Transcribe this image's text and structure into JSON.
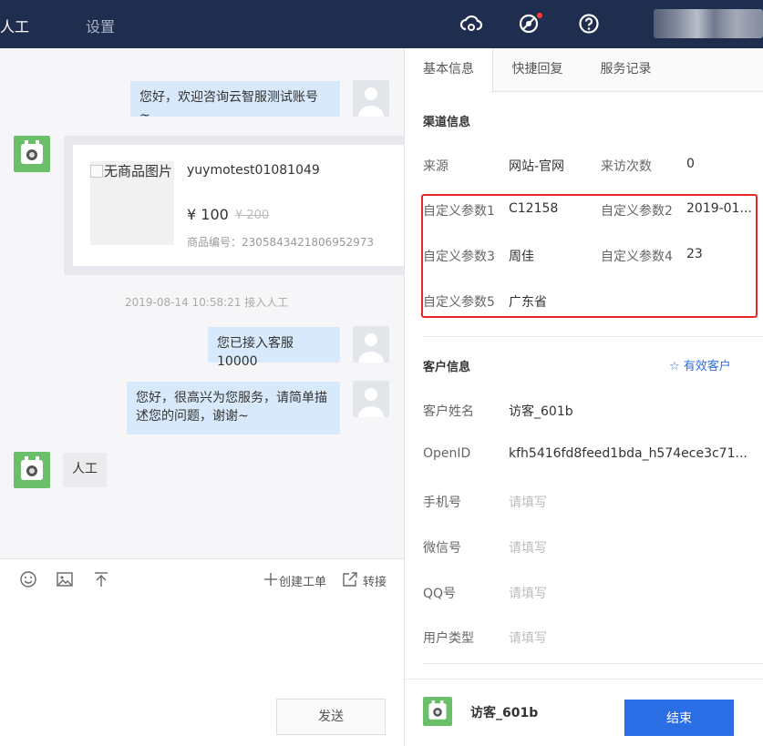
{
  "topbar": {
    "nav_active": "人工",
    "nav_settings": "设置"
  },
  "chat": {
    "msg_welcome": "您好，欢迎咨询云智服测试账号 ~",
    "product": {
      "image_alt": "无商品图片",
      "title": "yuymotest01081049",
      "price": "¥ 100",
      "old_price": "¥ 200",
      "code": "商品编号：2305843421806952973"
    },
    "time_note": "2019-08-14 10:58:21 接入人工",
    "msg_agent": "您已接入客服10000",
    "msg_service": "您好，很高兴为您服务，请简单描述您的问题，谢谢~",
    "msg_user": "人工"
  },
  "toolbar": {
    "create_ticket": "创建工单",
    "transfer": "转接",
    "send": "发送"
  },
  "right": {
    "tabs": [
      "基本信息",
      "快捷回复",
      "服务记录"
    ],
    "channel_title": "渠道信息",
    "channel": {
      "source_label": "来源",
      "source_value": "网站-官网",
      "visits_label": "来访次数",
      "visits_value": "0",
      "p1_label": "自定义参数1",
      "p1_value": "C12158",
      "p2_label": "自定义参数2",
      "p2_value": "2019-01...",
      "p3_label": "自定义参数3",
      "p3_value": "周佳",
      "p4_label": "自定义参数4",
      "p4_value": "23",
      "p5_label": "自定义参数5",
      "p5_value": "广东省"
    },
    "customer_title": "客户信息",
    "valid_customer": "有效客户",
    "customer": {
      "name_label": "客户姓名",
      "name_value": "访客_601b",
      "openid_label": "OpenID",
      "openid_value": "kfh5416fd8feed1bda_h574ece3c71...",
      "phone_label": "手机号",
      "phone_ph": "请填写",
      "wechat_label": "微信号",
      "wechat_ph": "请填写",
      "qq_label": "QQ号",
      "qq_ph": "请填写",
      "type_label": "用户类型",
      "type_ph": "请填写"
    },
    "footer_name": "访客_601b",
    "end_button": "结束"
  },
  "colors": {
    "topbar": "#1f2d4e",
    "primary": "#2b6de5",
    "highlight": "#e5262a",
    "bubble_out": "#d8e9fb"
  }
}
